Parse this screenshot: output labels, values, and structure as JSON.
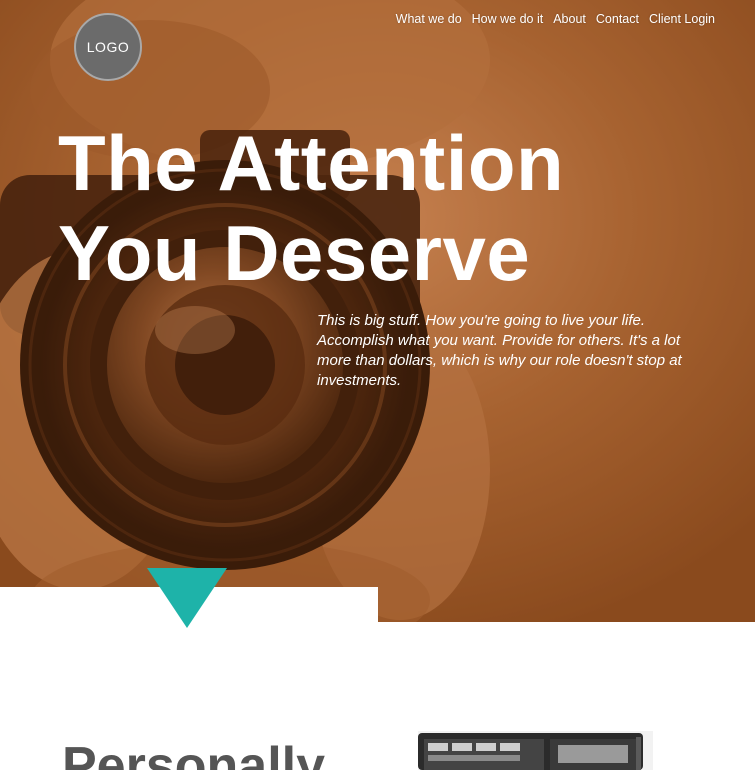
{
  "logo": {
    "label": "LOGO"
  },
  "nav": {
    "items": [
      {
        "label": "What we do"
      },
      {
        "label": "How we do it"
      },
      {
        "label": "About"
      },
      {
        "label": "Contact"
      },
      {
        "label": "Client Login"
      }
    ]
  },
  "hero": {
    "headline_line1": "The Attention",
    "headline_line2": "You Deserve",
    "tagline": "This is big stuff. How you're going to live your life. Accomplish what you want. Provide for others. It's a lot more than dollars, which is why our role doesn't stop at investments.",
    "overlay_color": "#8c4a1f"
  },
  "accent": {
    "pointer_color": "#1eb3a9"
  },
  "section": {
    "title": "Personally"
  }
}
